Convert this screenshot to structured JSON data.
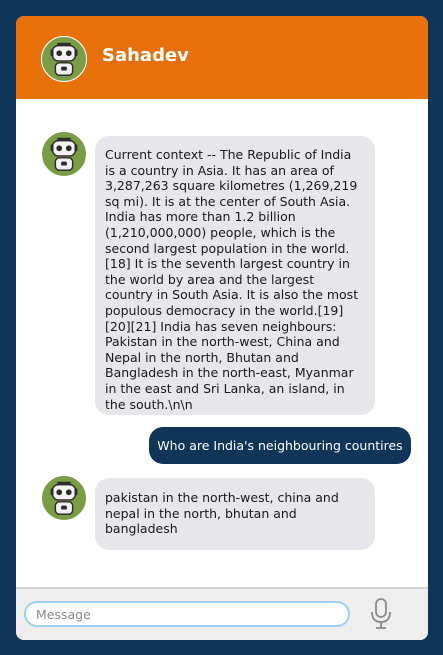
{
  "header": {
    "title": "Sahadev",
    "avatar_icon": "robot-icon"
  },
  "messages": [
    {
      "sender": "bot",
      "avatar_icon": "robot-icon",
      "text": "Current context -- The Republic of India is a country in Asia. It has an area of 3,287,263 square kilometres (1,269,219 sq mi). It is at the center of South Asia. India has more than 1.2 billion (1,210,000,000) people, which is the second largest population in the world.[18] It is the seventh largest country in the world by area and the largest country in South Asia. It is also the most populous democracy in the world.[19][20][21] India has seven neighbours: Pakistan in the north-west, China and Nepal in the north, Bhutan and Bangladesh in the north-east, Myanmar in the east and Sri Lanka, an island, in the south.\\n\\n"
    },
    {
      "sender": "user",
      "text": "Who are India's neighbouring countires"
    },
    {
      "sender": "bot",
      "avatar_icon": "robot-icon",
      "text": "pakistan in the north-west, china and nepal in the north, bhutan and bangladesh"
    }
  ],
  "composer": {
    "placeholder": "Message",
    "value": "",
    "mic_icon": "microphone-icon"
  },
  "colors": {
    "page_background": "#0f3558",
    "header": "#e8700b",
    "user_bubble": "#0f3558",
    "bot_bubble": "#e6e6eb",
    "avatar": "#7a9c46",
    "input_border": "#9fd0ee"
  }
}
